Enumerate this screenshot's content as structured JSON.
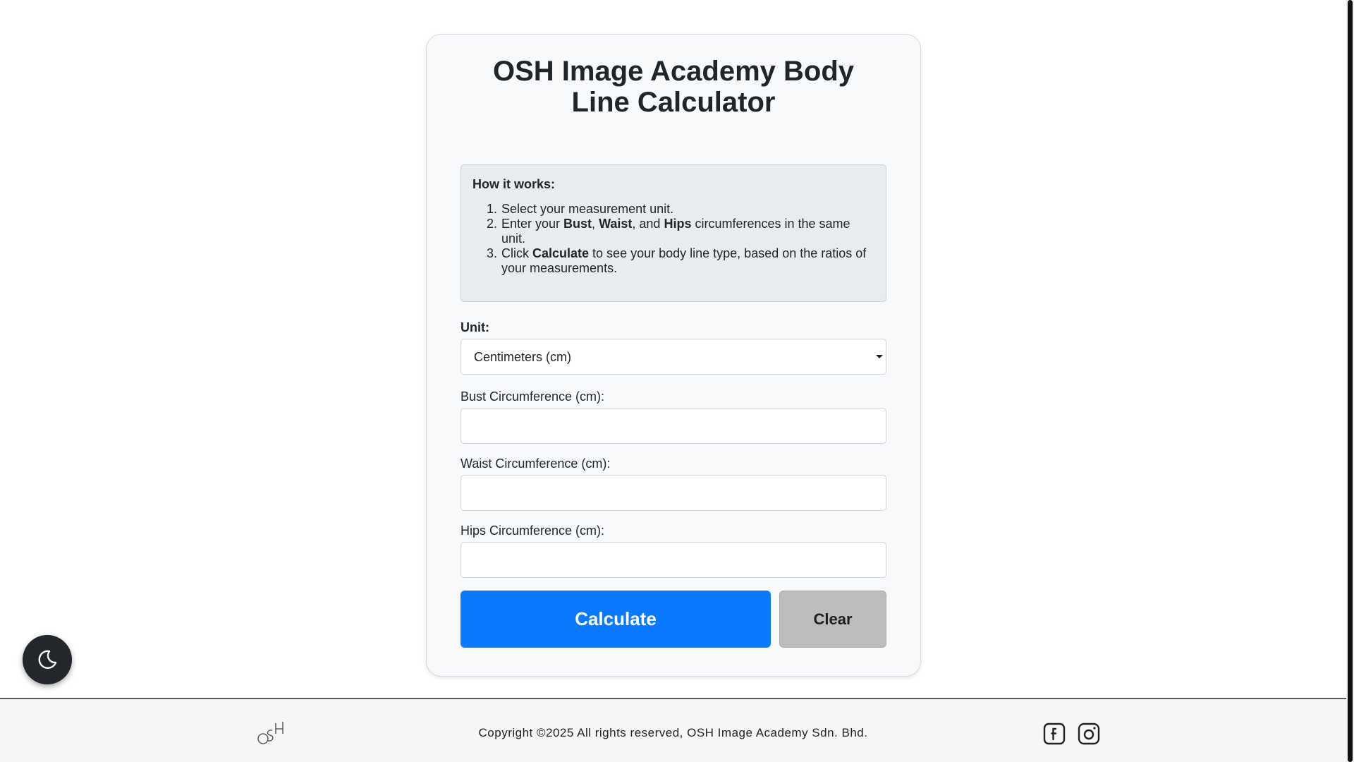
{
  "title": "OSH Image Academy Body Line Calculator",
  "how_it_works": {
    "heading": "How it works:",
    "step1": "Select your measurement unit.",
    "step2_a": "Enter your ",
    "step2_bust": "Bust",
    "step2_b": ", ",
    "step2_waist": "Waist",
    "step2_c": ", and ",
    "step2_hips": "Hips",
    "step2_d": " circumferences in the same unit.",
    "step3_a": "Click ",
    "step3_calc": "Calculate",
    "step3_b": " to see your body line type, based on the ratios of your measurements."
  },
  "unit": {
    "label": "Unit:",
    "selected": "Centimeters (cm)"
  },
  "fields": {
    "bust_label": "Bust Circumference (cm):",
    "bust_value": "",
    "waist_label": "Waist Circumference (cm):",
    "waist_value": "",
    "hips_label": "Hips Circumference (cm):",
    "hips_value": ""
  },
  "buttons": {
    "calculate": "Calculate",
    "clear": "Clear"
  },
  "theme_toggle": {
    "icon": "moon-icon"
  },
  "footer": {
    "logo_text": "OSH",
    "copyright": "Copyright ©2025 All rights reserved, OSH Image Academy Sdn. Bhd.",
    "social": [
      "facebook-icon",
      "instagram-icon"
    ]
  },
  "colors": {
    "primary": "#0a78ff",
    "clear_button": "#bdbdbd",
    "toggle": "#23272b"
  }
}
